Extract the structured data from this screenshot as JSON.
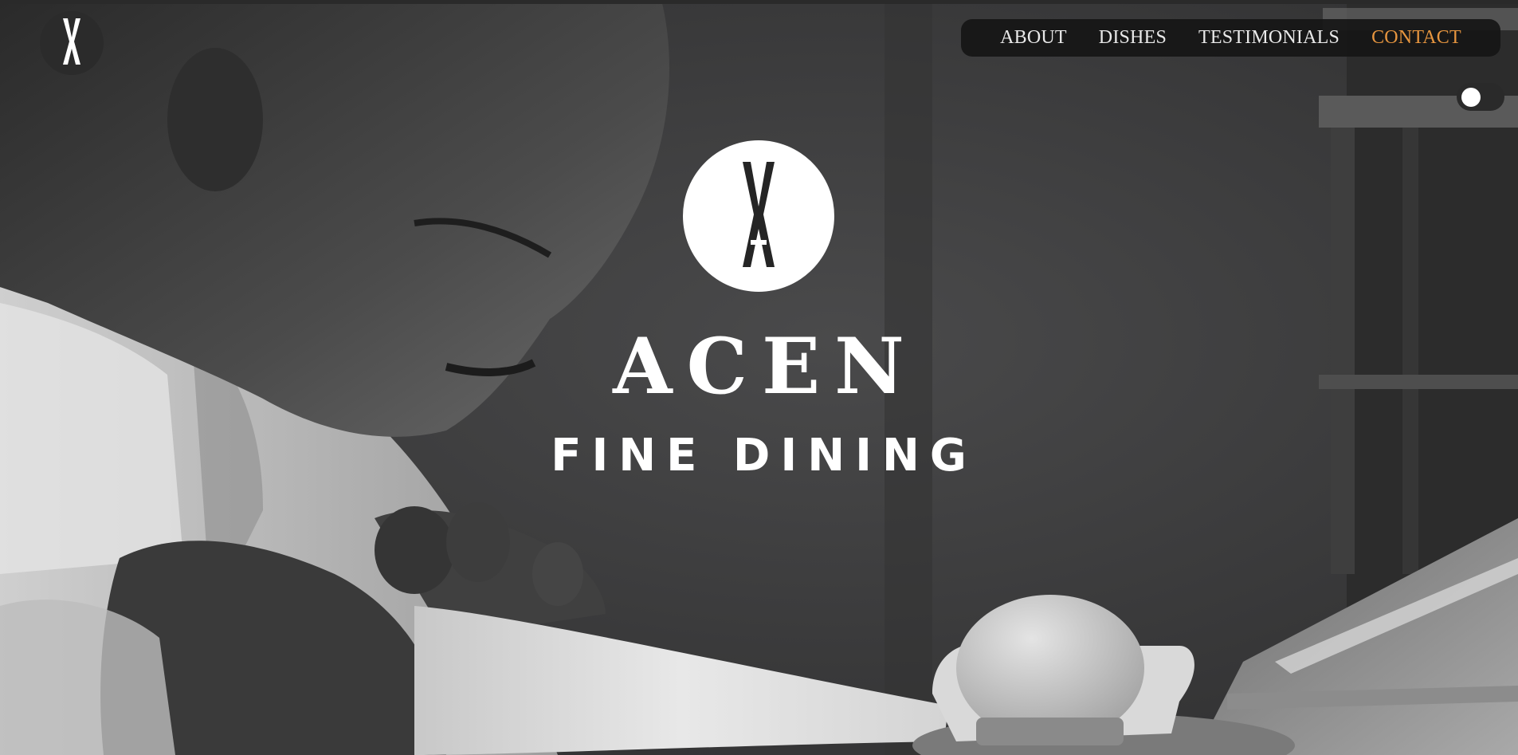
{
  "nav": {
    "items": [
      {
        "label": "ABOUT",
        "active": false
      },
      {
        "label": "DISHES",
        "active": false
      },
      {
        "label": "TESTIMONIALS",
        "active": false
      },
      {
        "label": "CONTACT",
        "active": true
      }
    ]
  },
  "hero": {
    "brand": "ACEN",
    "tagline": "FINE DINING",
    "background_icon": "chef-piping-dessert-photo"
  },
  "theme_toggle": {
    "state": "off",
    "icon": "theme-toggle-icon"
  },
  "logo": {
    "icon": "acen-logo-icon"
  },
  "colors": {
    "accent": "#e6953f",
    "nav_background": "#161616",
    "text": "#ffffff"
  }
}
